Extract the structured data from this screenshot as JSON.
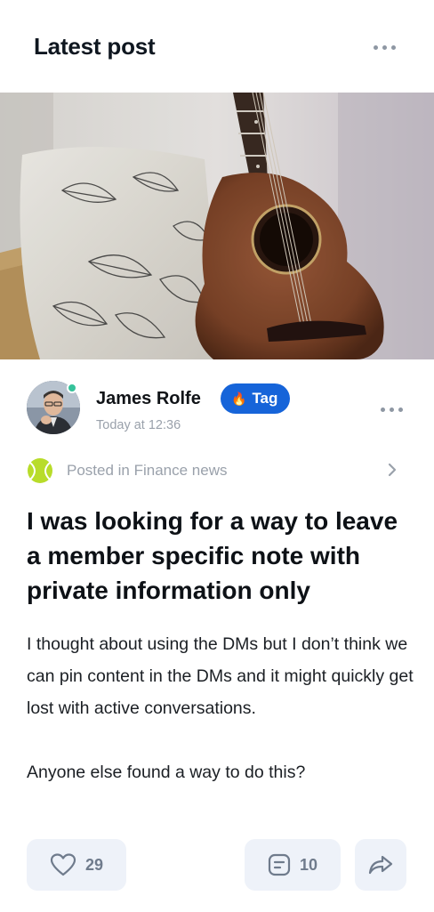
{
  "header": {
    "title": "Latest post"
  },
  "hero_image": {
    "alt": "Acoustic guitar leaning against a patterned leaf pillow"
  },
  "author": {
    "name": "James Rolfe",
    "timestamp": "Today at 12:36",
    "online": true,
    "status_color": "#35c29a"
  },
  "tag": {
    "icon": "fire-icon",
    "label": "Tag",
    "color": "#1664d9"
  },
  "category": {
    "icon": "tennis-ball-icon",
    "label": "Posted in Finance news"
  },
  "post": {
    "title": "I was looking for a way to leave a member specific note with private information only",
    "body_paragraph_1": "I thought about using the DMs but I don’t think we can pin content in the DMs and it might quickly get lost with active conversations.",
    "body_paragraph_2": "Anyone else found a way to do this?"
  },
  "actions": {
    "likes": "29",
    "comments": "10",
    "like_icon": "heart-icon",
    "comment_icon": "comment-icon",
    "share_icon": "share-icon"
  }
}
